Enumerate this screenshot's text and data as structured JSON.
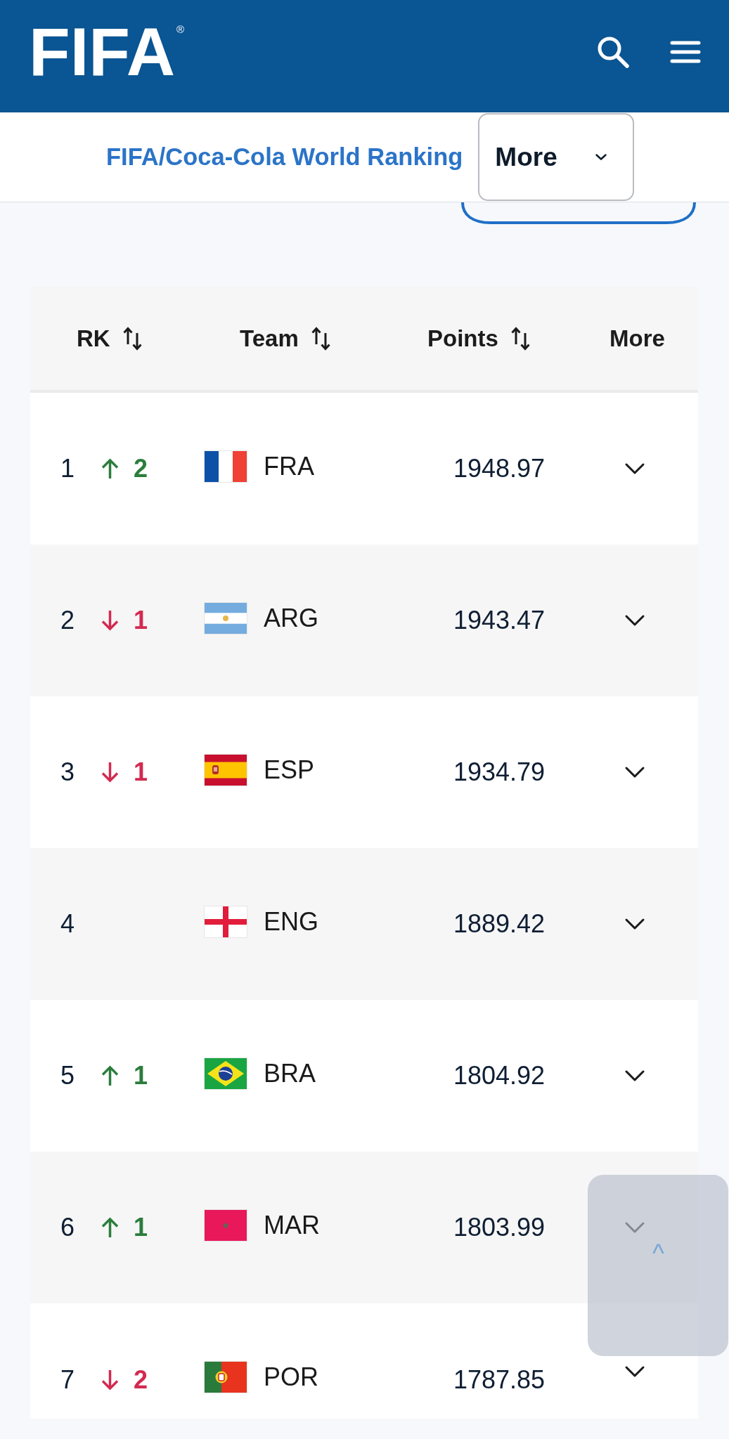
{
  "top_bar": {
    "logo": "FIFA$^{®}$"
  },
  "subnav": {
    "link": "FIFA/Coca-Cola World Ranking",
    "dropdown": {
      "label": "More",
      "expanded": false
    }
  },
  "table": {
    "columns": [
      {
        "label": "RK",
        "sortable": true
      },
      {
        "label": "Team",
        "sortable": true
      },
      {
        "label": "Points",
        "sortable": true
      },
      {
        "label": "More",
        "sortable": false
      }
    ],
    "rows": [
      {
        "rank": "1",
        "change": {
          "kind": "up",
          "value": "2"
        },
        "flag": {
          "kind": "france"
        },
        "team": "FRA",
        "points": "1948.97",
        "expanded": false
      },
      {
        "rank": "2",
        "change": {
          "kind": "down",
          "value": "1"
        },
        "flag": {
          "kind": "argentina"
        },
        "team": "ARG",
        "points": "1943.47",
        "expanded": false
      },
      {
        "rank": "3",
        "change": {
          "kind": "down",
          "value": "1"
        },
        "flag": {
          "kind": "spain"
        },
        "team": "ESP",
        "points": "1934.79",
        "expanded": false
      },
      {
        "rank": "4",
        "flag": {
          "kind": "england"
        },
        "team": "ENG",
        "points": "1889.42",
        "expanded": false
      },
      {
        "rank": "5",
        "change": {
          "kind": "up",
          "value": "1"
        },
        "flag": {
          "kind": "brazil"
        },
        "team": "BRA",
        "points": "1804.92",
        "expanded": false
      },
      {
        "rank": "6",
        "change": {
          "kind": "up",
          "value": "1"
        },
        "flag": {
          "kind": "morocco"
        },
        "team": "MAR",
        "points": "1803.99",
        "expanded": false
      },
      {
        "rank": "7",
        "change": {
          "kind": "down",
          "value": "2"
        },
        "flag": {
          "kind": "portugal"
        },
        "team": "POR",
        "points": "1787.85",
        "expanded": false
      }
    ]
  },
  "scroll_top_button": {
    "label": "^"
  }
}
